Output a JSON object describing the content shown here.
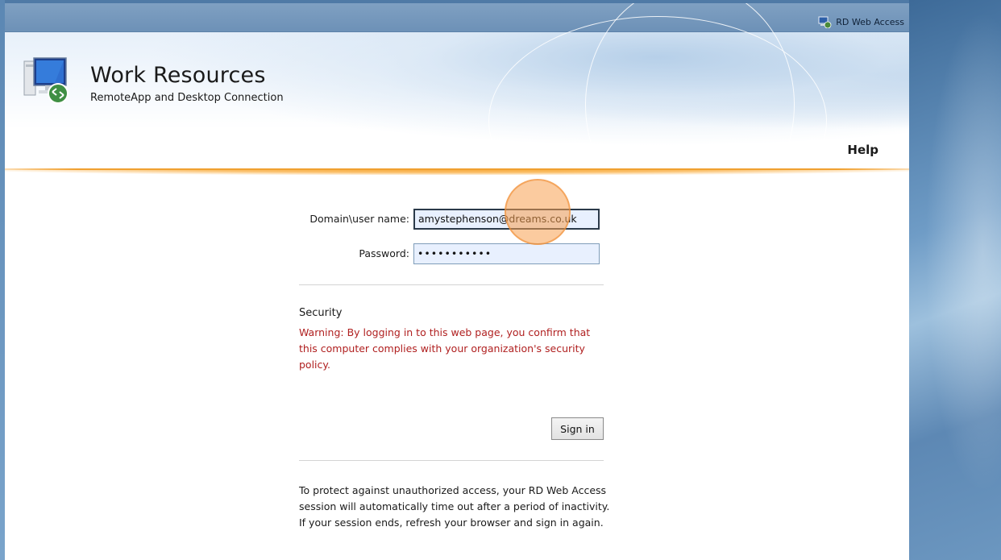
{
  "topbar": {
    "brand_label": "RD Web Access",
    "brand_icon": "rd-web-access-icon"
  },
  "header": {
    "title": "Work Resources",
    "subtitle": "RemoteApp and Desktop Connection",
    "help_link": "Help",
    "app_icon": "remote-desktop-icon"
  },
  "login": {
    "username_label": "Domain\\user name:",
    "username_value": "amystephenson@dreams.co.uk",
    "password_label": "Password:",
    "password_value": "•••••••••••",
    "security_title": "Security",
    "security_warning": "Warning: By logging in to this web page, you confirm that this computer complies with your organization's security policy.",
    "signin_label": "Sign in",
    "timeout_note": "To protect against unauthorized access, your RD Web Access session will automatically time out after a period of inactivity. If your session ends, refresh your browser and sign in again."
  },
  "colors": {
    "accent_orange": "#f0a030",
    "warning_red": "#b02020",
    "topbar_blue": "#7fa0c2",
    "cursor_highlight": "#f8a050"
  }
}
